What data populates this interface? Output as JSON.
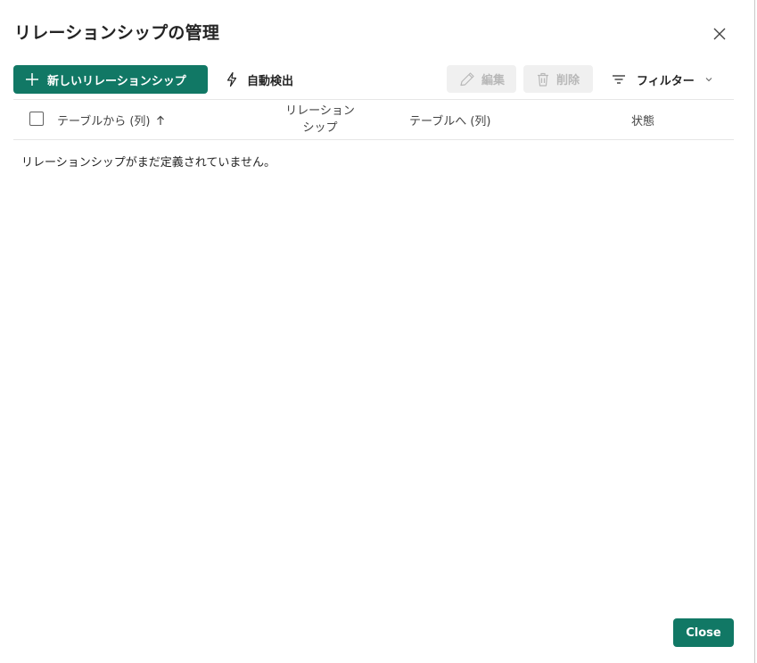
{
  "dialog": {
    "title": "リレーションシップの管理",
    "close_icon": "close-icon"
  },
  "toolbar": {
    "new_relationship_label": "新しいリレーションシップ",
    "autodetect_label": "自動検出",
    "edit_label": "編集",
    "delete_label": "削除",
    "filter_label": "フィルター",
    "icons": {
      "new": "plus-icon",
      "autodetect": "lightning-icon",
      "edit": "pencil-icon",
      "delete": "trash-icon",
      "filter": "filter-icon",
      "filter_dropdown": "chevron-down-icon"
    }
  },
  "table": {
    "columns": {
      "from_table": "テーブルから (列)",
      "relationship_line1": "リレーション",
      "relationship_line2": "シップ",
      "to_table": "テーブルへ (列)",
      "status": "状態"
    },
    "sort_icon": "arrow-up-icon",
    "empty_message": "リレーションシップがまだ定義されていません。"
  },
  "footer": {
    "close_label": "Close"
  },
  "colors": {
    "primary": "#117865",
    "disabled_bg": "#f0f0f0",
    "disabled_text": "#b8b8b8"
  }
}
